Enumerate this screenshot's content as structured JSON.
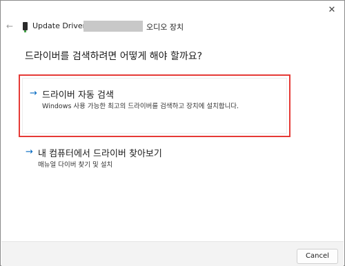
{
  "titlebar": {
    "back_icon": "←",
    "title_prefix": "Update Drivers -",
    "title_suffix": "오디오 장치",
    "close_icon": "✕"
  },
  "question": "드라이버를 검색하려면 어떻게 해야 할까요?",
  "options": [
    {
      "arrow": "→",
      "title": "드라이버 자동 검색",
      "description": "Windows 사용 가능한 최고의 드라이버를 검색하고 장치에 설치합니다.",
      "highlighted": true,
      "highlight_color": "#e53935"
    },
    {
      "arrow": "→",
      "title": "내 컴퓨터에서 드라이버 찾아보기",
      "description": "매뉴얼 다이버 찾기 및 설치",
      "highlighted": false
    }
  ],
  "footer": {
    "cancel_label": "Cancel"
  },
  "colors": {
    "accent": "#0067c0",
    "highlight": "#e53935"
  }
}
